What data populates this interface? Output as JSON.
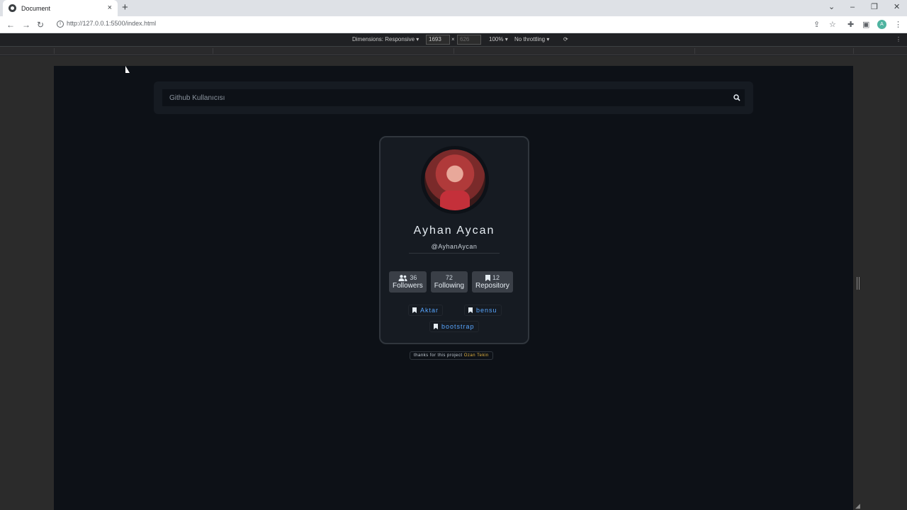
{
  "browser": {
    "tab_title": "Document",
    "url": "http://127.0.0.1:5500/index.html",
    "new_tab_symbol": "+",
    "close_tab_symbol": "×"
  },
  "devtools": {
    "dimensions_label": "Dimensions: Responsive",
    "width_value": "1693",
    "height_value": "626",
    "times": "×",
    "zoom": "100%",
    "throttling": "No throttling"
  },
  "page": {
    "search": {
      "placeholder": "Github Kullanıcısı",
      "value": ""
    },
    "profile": {
      "name": "Ayhan Aycan",
      "login": "@AyhanAycan",
      "stats": [
        {
          "value": "36",
          "label": "Followers",
          "icon": "users-icon"
        },
        {
          "value": "72",
          "label": "Following",
          "icon": ""
        },
        {
          "value": "12",
          "label": "Repository",
          "icon": "bookmark-icon"
        }
      ],
      "repos": [
        "Aktar",
        "bensu",
        "bootstrap"
      ]
    },
    "credit": {
      "text": "thanks for this project",
      "author": "Ozan Tekin"
    }
  },
  "colors": {
    "page_bg": "#0d1117",
    "card_bg": "#161b22",
    "repo_link": "#58a6ff",
    "author_highlight": "#e3b341"
  }
}
